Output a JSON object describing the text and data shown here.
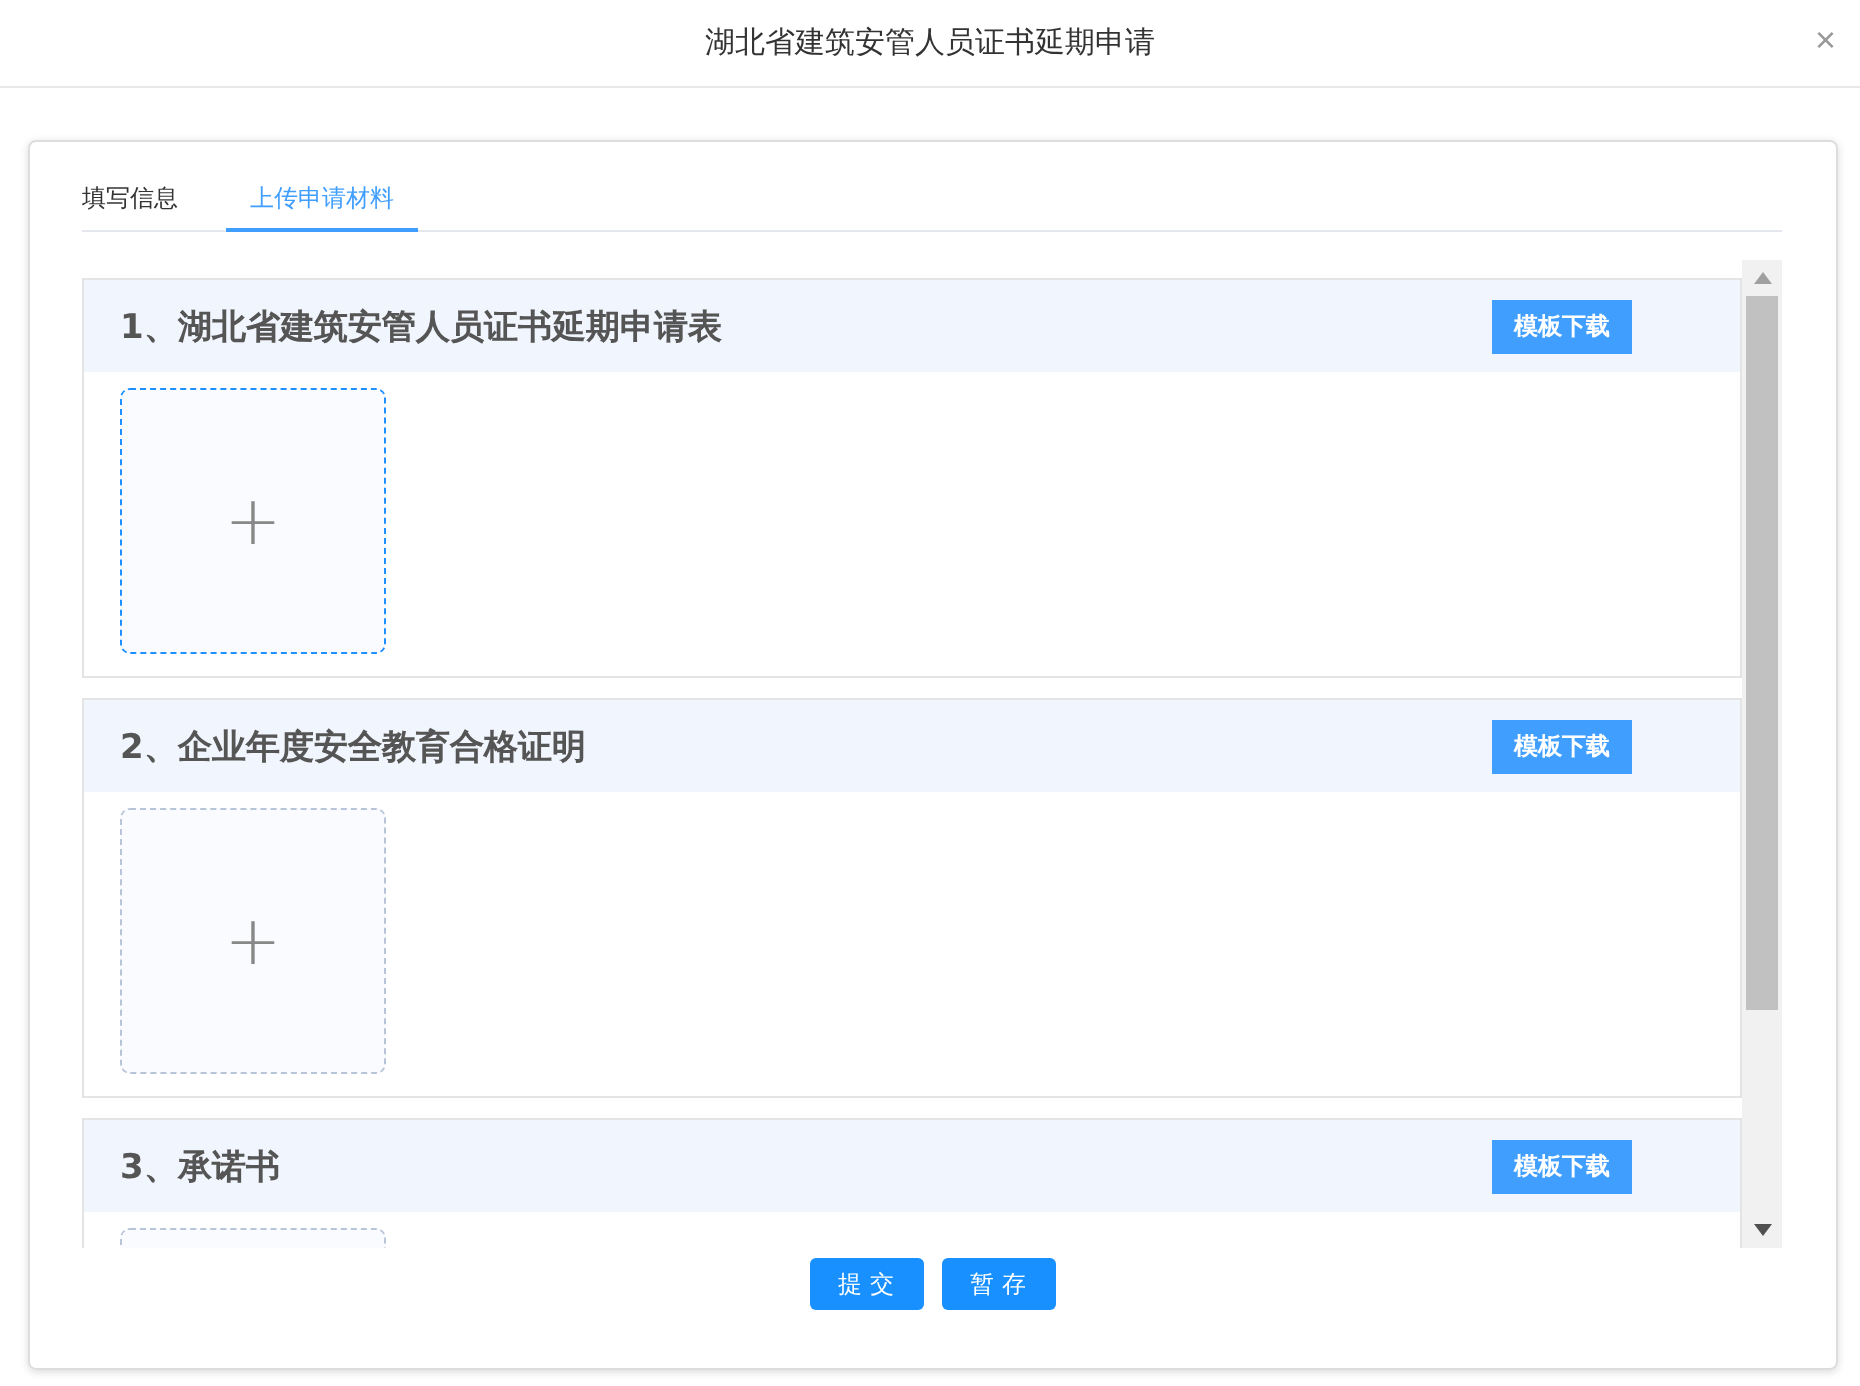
{
  "window": {
    "title": "湖北省建筑安管人员证书延期申请",
    "close": "×"
  },
  "tabs": [
    {
      "label": "填写信息",
      "selected": false
    },
    {
      "label": "上传申请材料",
      "selected": true
    }
  ],
  "sections": [
    {
      "title": "1、湖北省建筑安管人员证书延期申请表",
      "button": "模板下载",
      "upload": "+",
      "focused": true
    },
    {
      "title": "2、企业年度安全教育合格证明",
      "button": "模板下载",
      "upload": "+",
      "focused": false
    },
    {
      "title": "3、承诺书",
      "button": "模板下载",
      "focused": false
    }
  ],
  "buttons": [
    "提 交",
    "暂 存"
  ]
}
